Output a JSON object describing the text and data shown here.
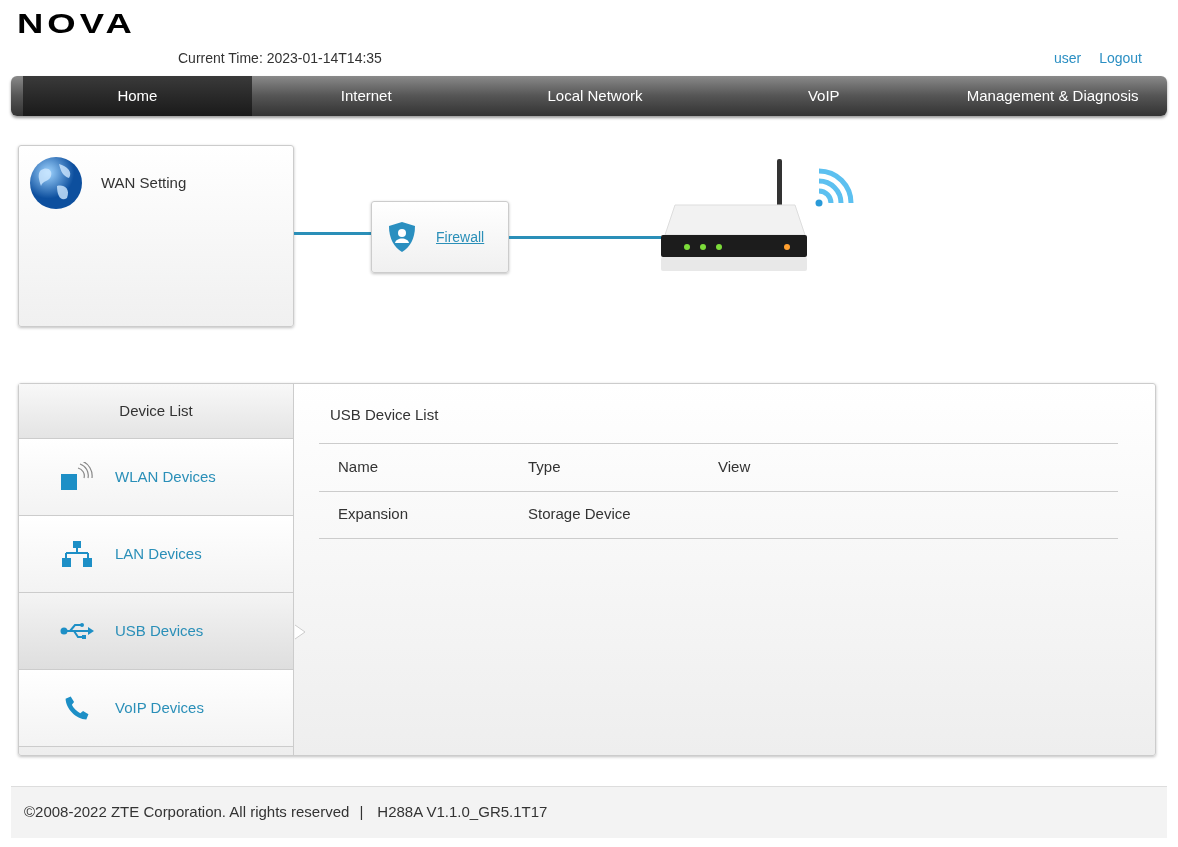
{
  "logo": "NOVA",
  "header": {
    "current_time": "Current Time: 2023-01-14T14:35",
    "user": "user",
    "logout": "Logout"
  },
  "nav": [
    {
      "label": "Home",
      "selected": true
    },
    {
      "label": "Internet",
      "selected": false
    },
    {
      "label": "Local Network",
      "selected": false
    },
    {
      "label": "VoIP",
      "selected": false
    },
    {
      "label": "Management & Diagnosis",
      "selected": false
    }
  ],
  "topology": {
    "wan": "WAN Setting",
    "firewall": "Firewall"
  },
  "device_list": {
    "title": "Device List",
    "items": [
      {
        "label": "WLAN Devices",
        "kind": "wlan",
        "selected": false
      },
      {
        "label": "LAN Devices",
        "kind": "lan",
        "selected": false
      },
      {
        "label": "USB Devices",
        "kind": "usb",
        "selected": true
      },
      {
        "label": "VoIP Devices",
        "kind": "voip",
        "selected": false
      }
    ]
  },
  "usb_list": {
    "title": "USB Device List",
    "columns": [
      "Name",
      "Type",
      "View"
    ],
    "rows": [
      [
        "Expansion",
        "Storage Device"
      ]
    ]
  },
  "footer": {
    "copyright": "©2008-2022 ZTE Corporation. All rights reserved",
    "separator": "|",
    "version": "H288A V1.1.0_GR5.1T17"
  }
}
